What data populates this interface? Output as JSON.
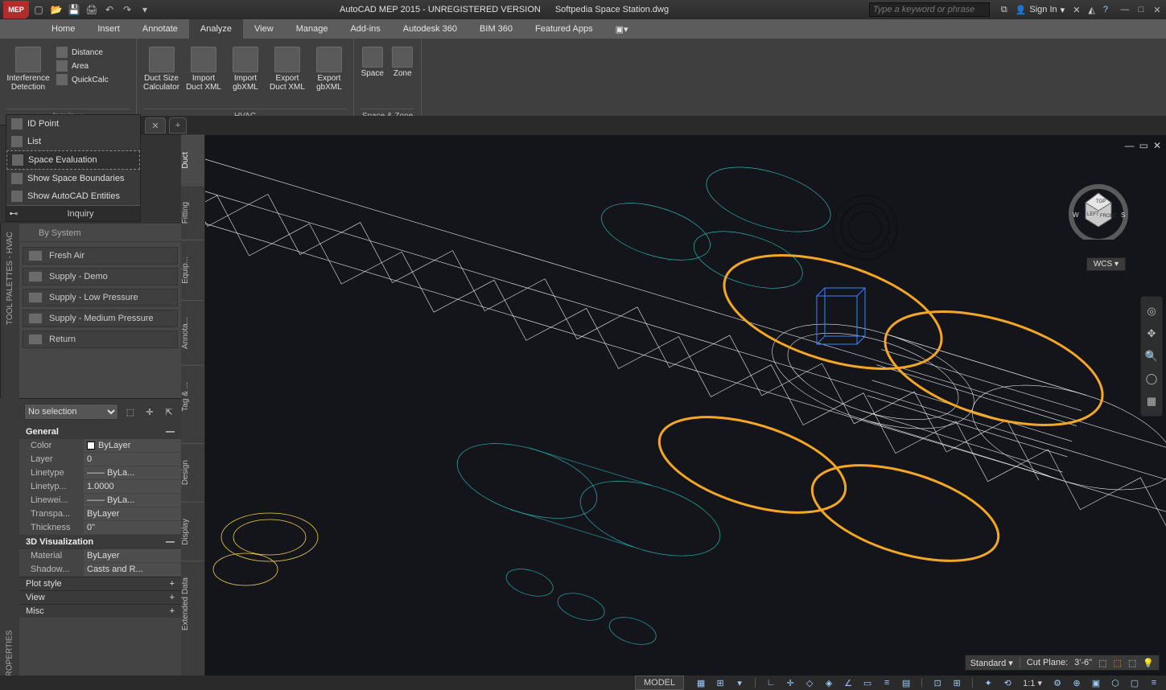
{
  "title": {
    "app": "AutoCAD MEP 2015 - UNREGISTERED VERSION",
    "file": "Softpedia Space Station.dwg",
    "logo": "MEP"
  },
  "search": {
    "placeholder": "Type a keyword or phrase"
  },
  "signin": "Sign In",
  "tabs": [
    "Home",
    "Insert",
    "Annotate",
    "Analyze",
    "View",
    "Manage",
    "Add-ins",
    "Autodesk 360",
    "BIM 360",
    "Featured Apps"
  ],
  "active_tab": "Analyze",
  "ribbon": {
    "interference": {
      "label": "Interference\nDetection",
      "small": [
        "Distance",
        "Area",
        "QuickCalc"
      ],
      "panel_title": "Inquiry ▾"
    },
    "hvac_buttons": [
      "Duct Size\nCalculator",
      "Import\nDuct XML",
      "Import\ngbXML",
      "Export\nDuct XML",
      "Export\ngbXML"
    ],
    "hvac_title": "HVAC",
    "spacezone_buttons": [
      "Space",
      "Zone"
    ],
    "spacezone_title": "Space & Zone ▾"
  },
  "inquiry_palette": {
    "items": [
      "ID Point",
      "List",
      "Space Evaluation",
      "Show Space Boundaries",
      "Show AutoCAD Entities"
    ],
    "selected": 2,
    "title": "Inquiry"
  },
  "tool_palette": {
    "strip": "TOOL PALETTES - HVAC",
    "group": "By System",
    "items": [
      "Fresh Air",
      "Supply - Demo",
      "Supply - Low Pressure",
      "Supply - Medium Pressure",
      "Return"
    ]
  },
  "palette_tabs": [
    "Duct",
    "Fitting",
    "Equip...",
    "Annota...",
    "Tag & ...",
    "Design",
    "Display",
    "Extended Data"
  ],
  "properties": {
    "strip": "PROPERTIES",
    "selection": "No selection",
    "cats": {
      "general": {
        "title": "General",
        "rows": [
          [
            "Color",
            "ByLayer"
          ],
          [
            "Layer",
            "0"
          ],
          [
            "Linetype",
            "—— ByLa..."
          ],
          [
            "Linetyp...",
            "1.0000"
          ],
          [
            "Linewei...",
            "—— ByLa..."
          ],
          [
            "Transpa...",
            "ByLayer"
          ],
          [
            "Thickness",
            "0\""
          ]
        ]
      },
      "viz": {
        "title": "3D Visualization",
        "rows": [
          [
            "Material",
            "ByLayer"
          ],
          [
            "Shadow...",
            "Casts and R..."
          ]
        ]
      }
    },
    "sections": [
      "Plot style",
      "View",
      "Misc"
    ]
  },
  "viewcube": {
    "top": "TOP",
    "front": "FRONT",
    "left": "LEFT",
    "wcs": "WCS ▾"
  },
  "annobar": {
    "standard": "Standard ▾",
    "cutplane_label": "Cut Plane:",
    "cutplane_val": "3'-6\""
  },
  "status": {
    "model": "MODEL",
    "scale": "1:1 ▾"
  }
}
